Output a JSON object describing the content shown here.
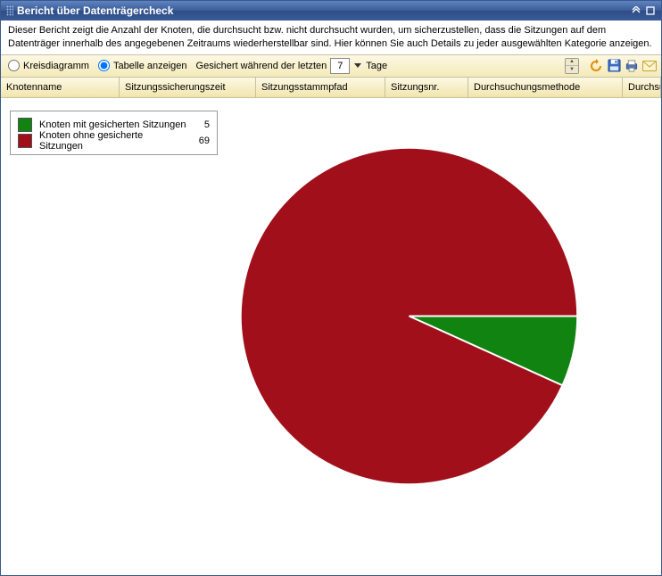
{
  "titlebar": {
    "title": "Bericht über Datenträgercheck"
  },
  "description": "Dieser Bericht zeigt die Anzahl der Knoten, die durchsucht bzw. nicht durchsucht wurden, um sicherzustellen, dass die Sitzungen auf dem Datenträger innerhalb des angegebenen Zeitraums wiederherstellbar sind. Hier können Sie auch Details zu jeder ausgewählten Kategorie anzeigen.",
  "toolbar": {
    "radio_pie": "Kreisdiagramm",
    "radio_table": "Tabelle anzeigen",
    "selected_radio": "table",
    "secured_prefix": "Gesichert während der letzten",
    "days_value": "7",
    "days_suffix": "Tage"
  },
  "columns": [
    "Knotenname",
    "Sitzungssicherungszeit",
    "Sitzungsstammpfad",
    "Sitzungsnr.",
    "Durchsuchungsmethode",
    "Durchsuchungssta"
  ],
  "legend": {
    "items": [
      {
        "label": "Knoten mit gesicherten Sitzungen",
        "value": "5",
        "color": "#118311"
      },
      {
        "label": "Knoten ohne gesicherte Sitzungen",
        "value": "69",
        "color": "#a10f1a"
      }
    ]
  },
  "chart_data": {
    "type": "pie",
    "title": "",
    "series": [
      {
        "name": "Knoten mit gesicherten Sitzungen",
        "value": 5,
        "color": "#118311"
      },
      {
        "name": "Knoten ohne gesicherte Sitzungen",
        "value": 69,
        "color": "#a10f1a"
      }
    ]
  }
}
